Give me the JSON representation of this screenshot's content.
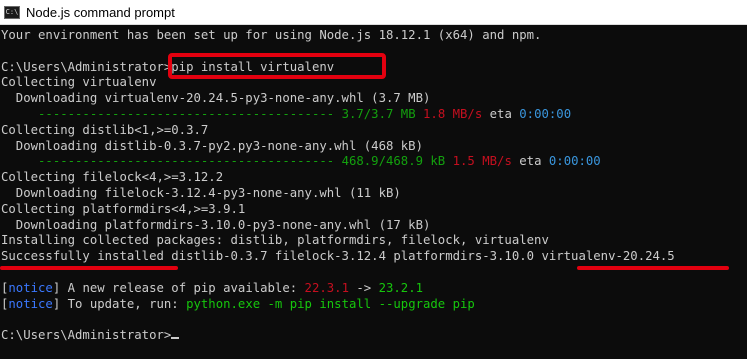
{
  "window": {
    "title": "Node.js command prompt",
    "icon_name": "console-app-icon",
    "icon_glyph": "C:\\"
  },
  "console": {
    "env_line": "Your environment has been set up for using Node.js 18.12.1 (x64) and npm.",
    "prompt1": "C:\\Users\\Administrator>",
    "command1": "pip install virtualenv",
    "collecting_virtualenv": "Collecting virtualenv",
    "downloading_virtualenv": "  Downloading virtualenv-20.24.5-py3-none-any.whl (3.7 MB)",
    "progress1": {
      "bar": "     ---------------------------------------- ",
      "done": "3.7/3.7 MB",
      "rate": "1.8 MB/s",
      "eta_label": "eta",
      "eta": "0:00:00"
    },
    "collecting_distlib": "Collecting distlib<1,>=0.3.7",
    "downloading_distlib": "  Downloading distlib-0.3.7-py2.py3-none-any.whl (468 kB)",
    "progress2": {
      "bar": "     ---------------------------------------- ",
      "done": "468.9/468.9 kB",
      "rate": "1.5 MB/s",
      "eta_label": "eta",
      "eta": "0:00:00"
    },
    "collecting_filelock": "Collecting filelock<4,>=3.12.2",
    "downloading_filelock": "  Downloading filelock-3.12.4-py3-none-any.whl (11 kB)",
    "collecting_platformdirs": "Collecting platformdirs<4,>=3.9.1",
    "downloading_platformdirs": "  Downloading platformdirs-3.10.0-py3-none-any.whl (17 kB)",
    "installing": "Installing collected packages: distlib, platformdirs, filelock, virtualenv",
    "success": "Successfully installed distlib-0.3.7 filelock-3.12.4 platformdirs-3.10.0 virtualenv-20.24.5",
    "notice1": {
      "tag": "notice",
      "text": " A new release of pip available: ",
      "old_version": "22.3.1",
      "arrow": " -> ",
      "new_version": "23.2.1"
    },
    "notice2": {
      "tag": "notice",
      "text": " To update, run: ",
      "command": "python.exe -m pip install --upgrade pip"
    },
    "prompt2": "C:\\Users\\Administrator>"
  },
  "colors": {
    "background": "#0c0c0c",
    "text": "#cccccc",
    "progress_green": "#13a10e",
    "rate_red": "#c50f1f",
    "eta_cyan": "#3a96dd",
    "notice_blue": "#3b78ff",
    "annotation_red": "#e3000f"
  }
}
